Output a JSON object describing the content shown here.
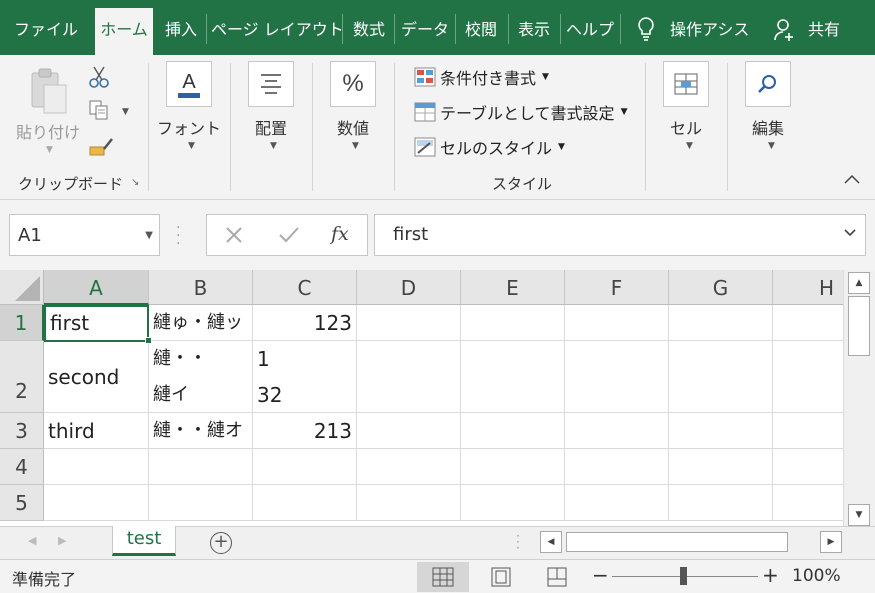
{
  "tabs": [
    {
      "label": "ファイル",
      "active": false
    },
    {
      "label": "ホーム",
      "active": true
    },
    {
      "label": "挿入",
      "active": false
    },
    {
      "label": "ページ レイアウト",
      "active": false
    },
    {
      "label": "数式",
      "active": false
    },
    {
      "label": "データ",
      "active": false
    },
    {
      "label": "校閲",
      "active": false
    },
    {
      "label": "表示",
      "active": false
    },
    {
      "label": "ヘルプ",
      "active": false
    }
  ],
  "tellme": "操作アシス",
  "share": "共有",
  "ribbon": {
    "clipboard": {
      "paste": "貼り付け",
      "group": "クリップボード"
    },
    "font": {
      "label": "フォント"
    },
    "align": {
      "label": "配置"
    },
    "number": {
      "label": "数値"
    },
    "styles": {
      "conditional": "条件付き書式",
      "table": "テーブルとして書式設定",
      "cellstyle": "セルのスタイル",
      "group": "スタイル"
    },
    "cells": {
      "label": "セル"
    },
    "edit": {
      "label": "編集"
    }
  },
  "formula_bar": {
    "name_box": "A1",
    "fx": "fx",
    "value": "first"
  },
  "grid": {
    "columns": [
      "A",
      "B",
      "C",
      "D",
      "E",
      "F",
      "G",
      "H"
    ],
    "rows": [
      "1",
      "2",
      "3",
      "4",
      "5"
    ],
    "cells": {
      "A1": "first",
      "B1": "縺ゅ・縺ッ",
      "C1": "123",
      "A2": "second",
      "B2a": "縺・・",
      "B2b": "縺イ",
      "C2a": "1",
      "C2b": "32",
      "A3": "third",
      "B3": "縺・・縺オ",
      "C3": "213"
    }
  },
  "sheets": [
    "test"
  ],
  "status": {
    "ready": "準備完了",
    "zoom": "100%"
  },
  "colors": {
    "accent": "#217346"
  }
}
